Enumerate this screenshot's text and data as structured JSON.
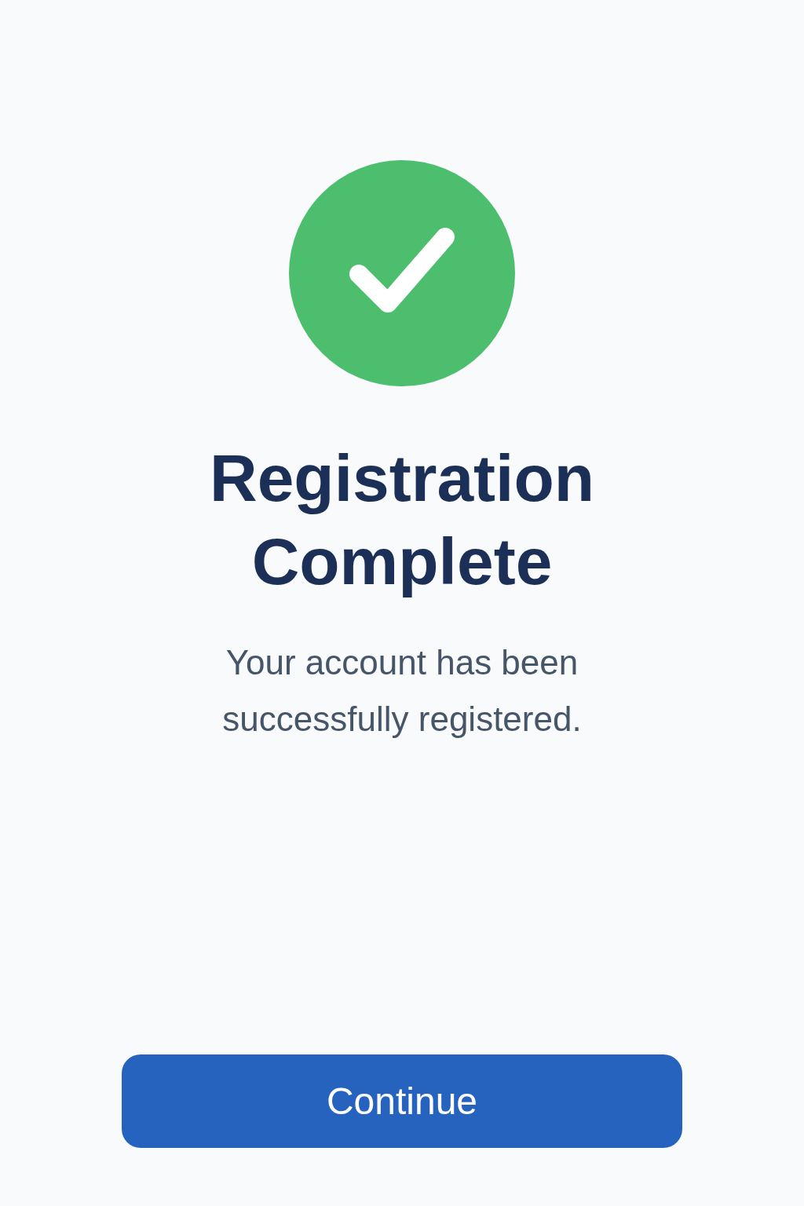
{
  "title": "Registration Complete",
  "message": "Your account has been successfully registered.",
  "button": {
    "label": "Continue"
  }
}
